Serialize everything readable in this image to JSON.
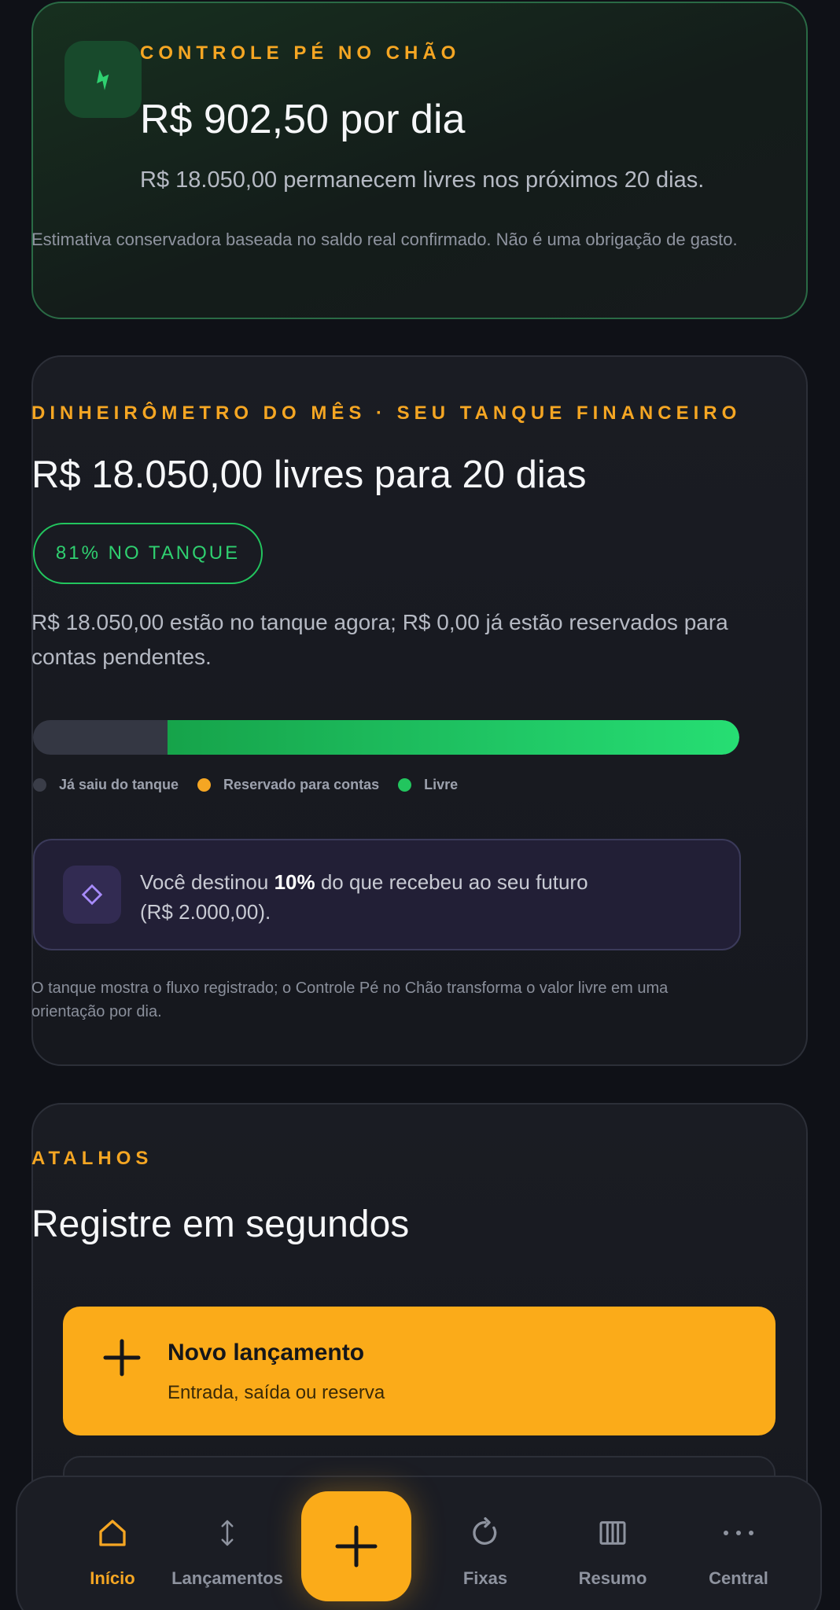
{
  "control_card": {
    "eyebrow": "CONTROLE PÉ NO CHÃO",
    "amount": "R$ 902,50 por dia",
    "subtitle": "R$ 18.050,00 permanecem livres nos próximos 20 dias.",
    "note": "Estimativa conservadora baseada no saldo real confirmado. Não é uma obrigação de gasto.",
    "icon": "bolt-icon"
  },
  "tank_card": {
    "eyebrow": "DINHEIRÔMETRO DO MÊS · SEU TANQUE FINANCEIRO",
    "title": "R$ 18.050,00 livres para 20 dias",
    "pill": "81% NO TANQUE",
    "description": "R$ 18.050,00 estão no tanque agora; R$ 0,00 já estão reservados para contas pendentes.",
    "bar": {
      "left_fraction": 0.19,
      "reserved_fraction": 0,
      "free_fraction": 0.81
    },
    "legend": [
      {
        "label": "Já saiu do tanque",
        "color": "#3a3d48"
      },
      {
        "label": "Reservado para contas",
        "color": "#f5a623"
      },
      {
        "label": "Livre",
        "color": "#22c55e"
      }
    ],
    "future": {
      "prefix": "Você destinou ",
      "percent": "10%",
      "suffix": " do que recebeu ao seu futuro",
      "line2": "(R$ 2.000,00).",
      "icon": "diamond-icon"
    },
    "note": "O tanque mostra o fluxo registrado; o Controle Pé no Chão transforma o valor livre em uma orientação por dia."
  },
  "shortcuts_card": {
    "eyebrow": "ATALHOS",
    "title": "Registre em segundos",
    "new_entry": {
      "title": "Novo lançamento",
      "subtitle": "Entrada, saída ou reserva"
    }
  },
  "nav": {
    "items": [
      {
        "label": "Início",
        "icon": "home-icon",
        "active": true
      },
      {
        "label": "Lançamentos",
        "icon": "arrows-updown-icon",
        "active": false
      },
      {
        "label": "Fixas",
        "icon": "refresh-icon",
        "active": false
      },
      {
        "label": "Resumo",
        "icon": "columns-icon",
        "active": false
      },
      {
        "label": "Central",
        "icon": "more-icon",
        "active": false
      }
    ],
    "fab_icon": "plus-icon"
  },
  "colors": {
    "accent": "#f5a623",
    "success": "#22c55e",
    "background": "#0f1117"
  }
}
